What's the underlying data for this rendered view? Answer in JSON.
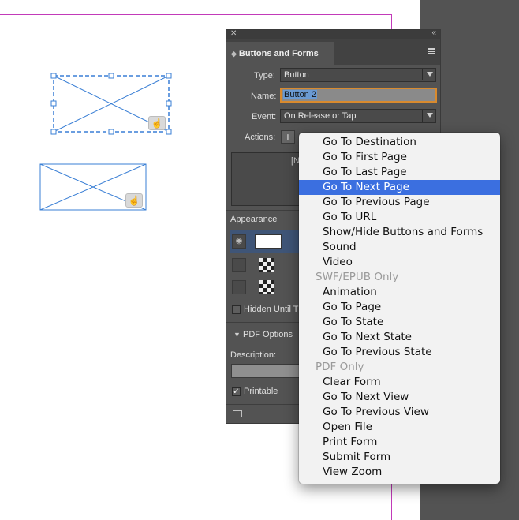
{
  "panel": {
    "title": "Buttons and Forms",
    "type_label": "Type:",
    "type_value": "Button",
    "name_label": "Name:",
    "name_value": "Button 2",
    "event_label": "Event:",
    "event_value": "On Release or Tap",
    "actions_label": "Actions:",
    "add_action": "+",
    "actions_placeholder": "[N",
    "appearance_label": "Appearance",
    "hidden_until_label": "Hidden Until T",
    "pdf_options_label": "PDF Options",
    "description_label": "Description:",
    "printable_label": "Printable",
    "printable_checked": "✓"
  },
  "menu": {
    "items": [
      {
        "label": "Go To Destination",
        "state": "normal"
      },
      {
        "label": "Go To First Page",
        "state": "normal"
      },
      {
        "label": "Go To Last Page",
        "state": "normal"
      },
      {
        "label": "Go To Next Page",
        "state": "highlighted"
      },
      {
        "label": "Go To Previous Page",
        "state": "normal"
      },
      {
        "label": "Go To URL",
        "state": "normal"
      },
      {
        "label": "Show/Hide Buttons and Forms",
        "state": "normal"
      },
      {
        "label": "Sound",
        "state": "normal"
      },
      {
        "label": "Video",
        "state": "normal"
      },
      {
        "label": "SWF/EPUB Only",
        "state": "header"
      },
      {
        "label": "Animation",
        "state": "normal"
      },
      {
        "label": "Go To Page",
        "state": "normal"
      },
      {
        "label": "Go To State",
        "state": "normal"
      },
      {
        "label": "Go To Next State",
        "state": "normal"
      },
      {
        "label": "Go To Previous State",
        "state": "normal"
      },
      {
        "label": "PDF Only",
        "state": "header"
      },
      {
        "label": "Clear Form",
        "state": "normal"
      },
      {
        "label": "Go To Next View",
        "state": "normal"
      },
      {
        "label": "Go To Previous View",
        "state": "normal"
      },
      {
        "label": "Open File",
        "state": "normal"
      },
      {
        "label": "Print Form",
        "state": "normal"
      },
      {
        "label": "Submit Form",
        "state": "normal"
      },
      {
        "label": "View Zoom",
        "state": "normal"
      }
    ]
  },
  "colors": {
    "highlight": "#3b6fe0",
    "page_edge": "#c23ab9",
    "frame": "#3a7fd5"
  },
  "icons": [
    "close-icon",
    "collapse-icon",
    "panel-menu-icon",
    "dropdown-caret-icon",
    "eye-icon",
    "hand-cursor-icon",
    "disclosure-triangle-icon",
    "preview-icon"
  ]
}
